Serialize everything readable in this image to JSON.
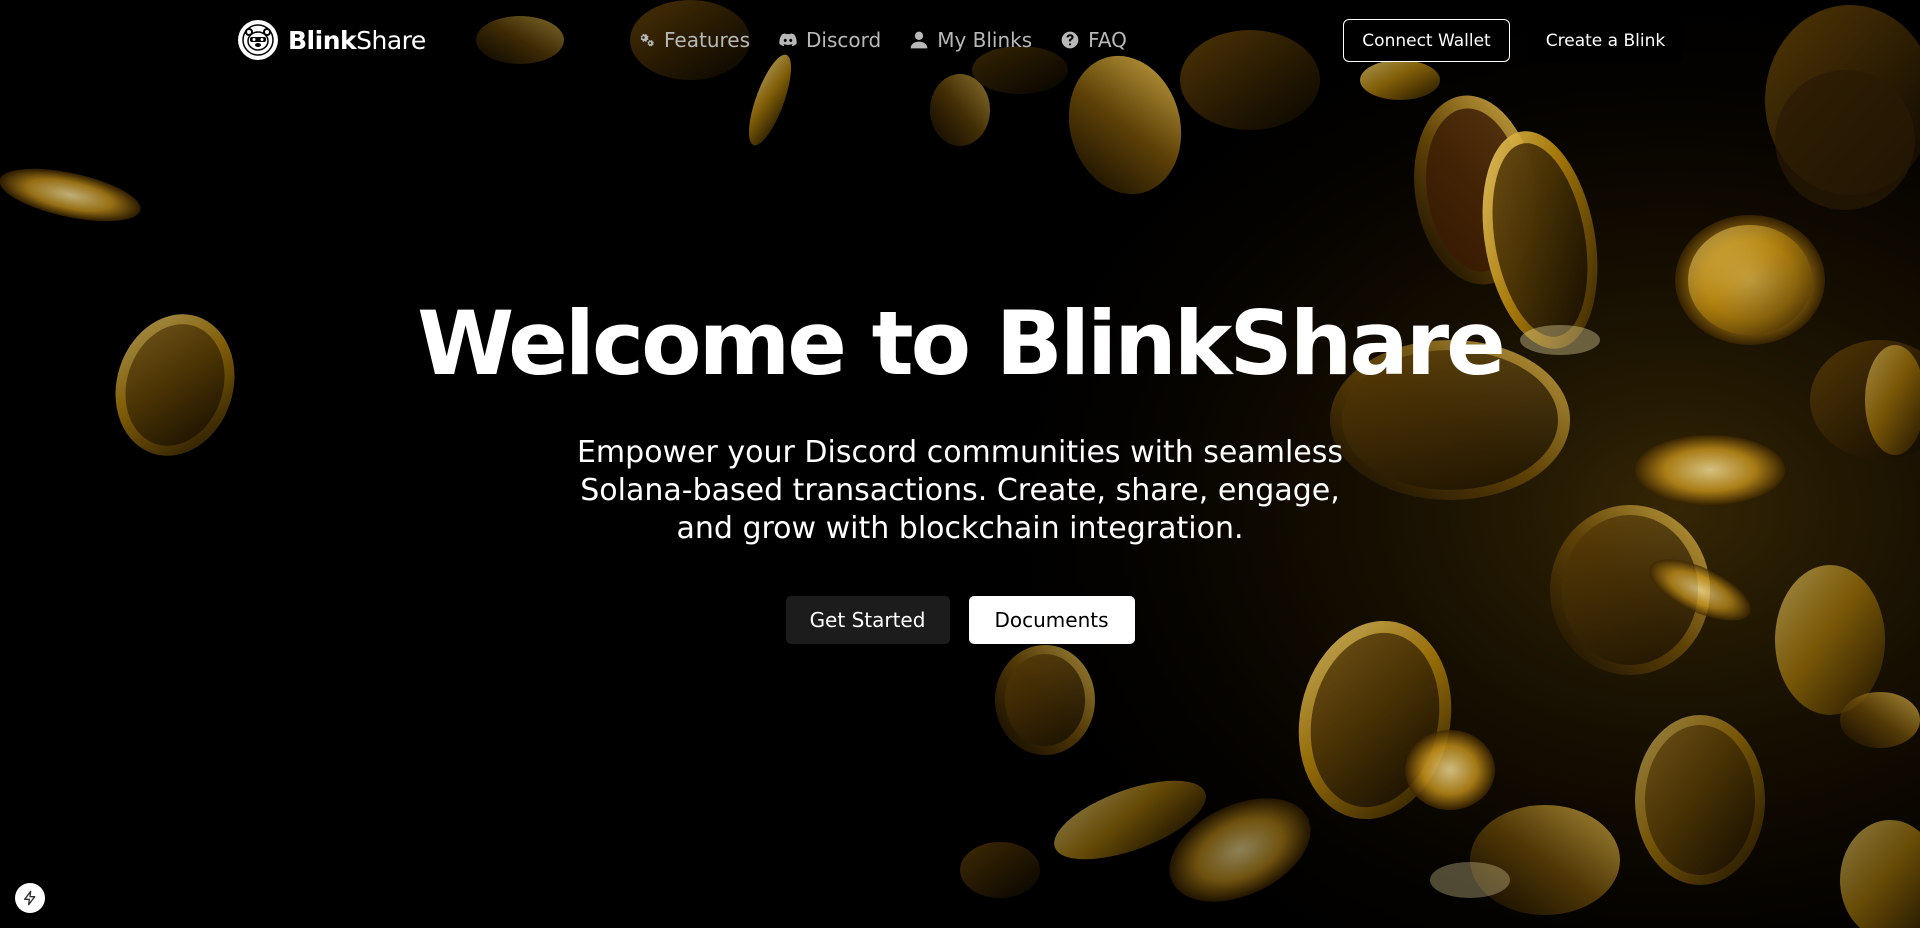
{
  "brand": {
    "name_bold": "Blink",
    "name_regular": "Share",
    "logo_icon": "bear-face-icon"
  },
  "nav": {
    "items": [
      {
        "label": "Features",
        "icon": "gears-icon"
      },
      {
        "label": "Discord",
        "icon": "discord-icon"
      },
      {
        "label": "My Blinks",
        "icon": "user-icon"
      },
      {
        "label": "FAQ",
        "icon": "question-circle-icon"
      }
    ],
    "connect_wallet": "Connect Wallet",
    "create_blink": "Create a Blink"
  },
  "hero": {
    "title": "Welcome to BlinkShare",
    "subtitle": "Empower your Discord communities with seamless Solana-based transactions. Create, share, engage, and grow with blockchain integration.",
    "get_started": "Get Started",
    "documents": "Documents"
  },
  "corner_badge_icon": "lightning-icon",
  "colors": {
    "background": "#000000",
    "nav_text": "#b8b8b8",
    "coin_gold": "#d4a020",
    "button_dark": "#1c1c1c"
  }
}
